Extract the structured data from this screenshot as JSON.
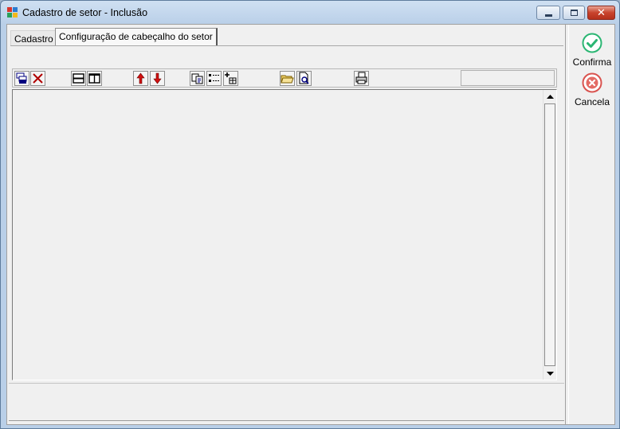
{
  "window": {
    "title": "Cadastro de setor - Inclusão",
    "colors": {
      "close_button": "#c8432d",
      "accent": "#b9cfe8"
    }
  },
  "tabs": [
    {
      "label": "Cadastro",
      "active": false
    },
    {
      "label": "Configuração de cabeçalho do setor",
      "active": true
    }
  ],
  "toolbar": {
    "icons": [
      "add-rows-icon",
      "delete-icon",
      "split-horizontal-icon",
      "split-vertical-icon",
      "move-up-icon",
      "move-down-icon",
      "copy-icon",
      "list-icon",
      "insert-field-icon",
      "open-folder-icon",
      "preview-icon",
      "print-icon"
    ]
  },
  "actions": {
    "confirm_label": "Confirma",
    "cancel_label": "Cancela",
    "confirm_color": "#2bb673",
    "cancel_color": "#d9534f"
  }
}
